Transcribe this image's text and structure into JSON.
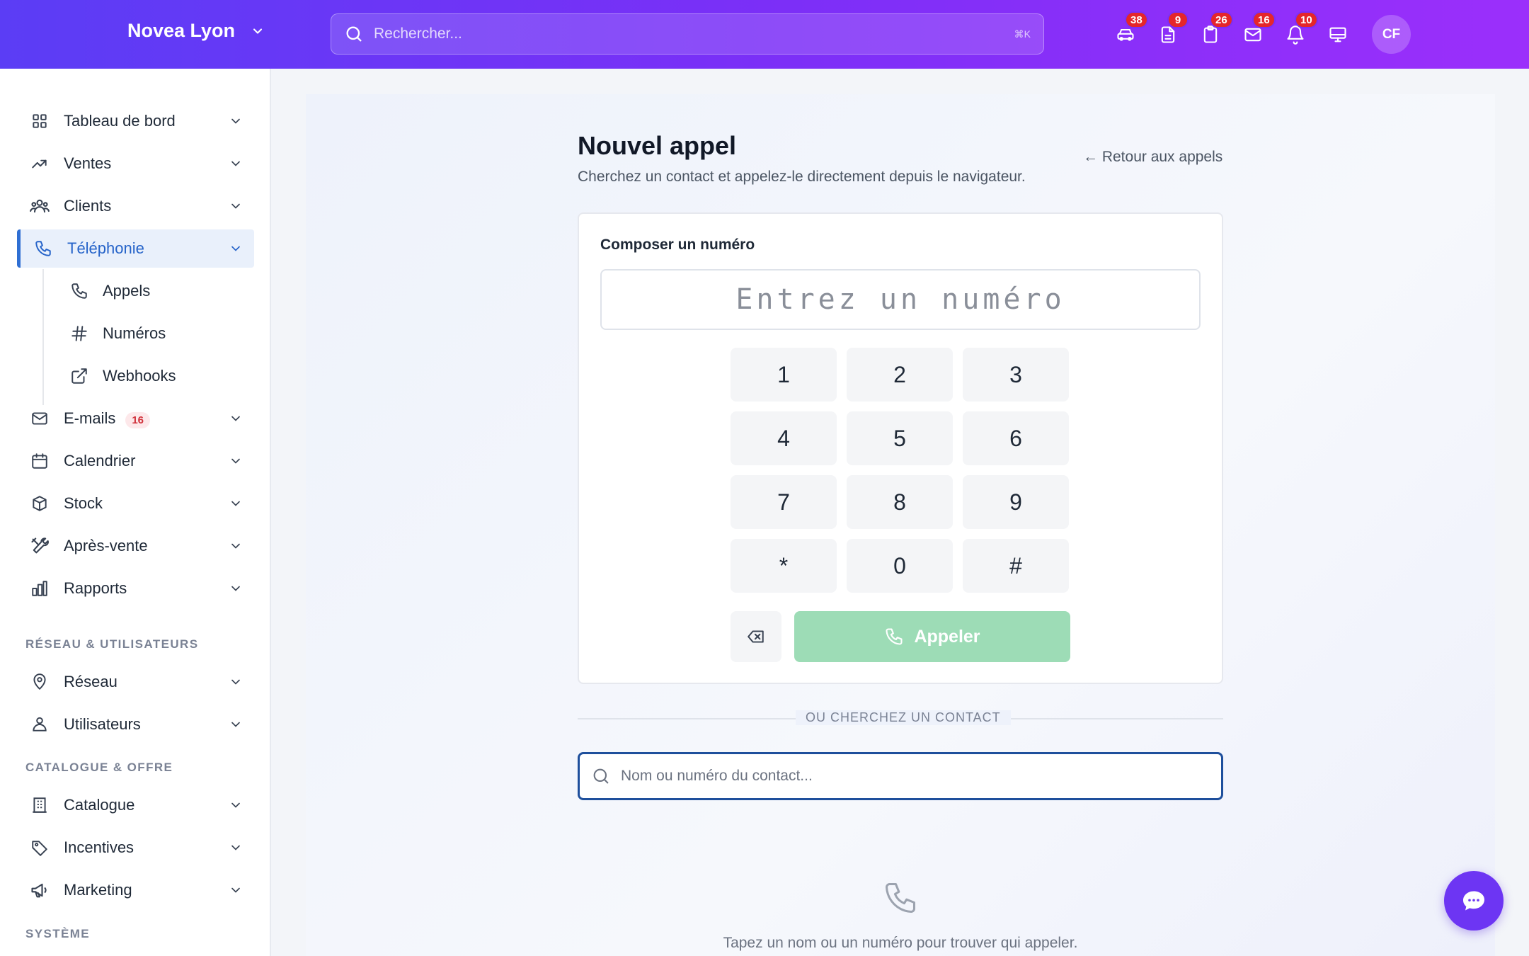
{
  "header": {
    "brand": "Novea Lyon",
    "search_placeholder": "Rechercher...",
    "search_shortcut": "⌘K",
    "icons": [
      {
        "name": "car-icon",
        "badge": "38"
      },
      {
        "name": "document-icon",
        "badge": "9"
      },
      {
        "name": "clipboard-icon",
        "badge": "26"
      },
      {
        "name": "mail-icon",
        "badge": "16"
      },
      {
        "name": "bell-icon",
        "badge": "10"
      },
      {
        "name": "monitor-icon",
        "badge": ""
      }
    ],
    "avatar": "CF"
  },
  "sidebar": {
    "items": [
      {
        "label": "Tableau de bord",
        "icon": "grid-icon"
      },
      {
        "label": "Ventes",
        "icon": "trend-icon"
      },
      {
        "label": "Clients",
        "icon": "users-icon"
      },
      {
        "label": "Téléphonie",
        "icon": "phone-icon",
        "active": true
      },
      {
        "label": "E-mails",
        "icon": "mail-icon",
        "count": "16"
      },
      {
        "label": "Calendrier",
        "icon": "calendar-icon"
      },
      {
        "label": "Stock",
        "icon": "box-icon"
      },
      {
        "label": "Après-vente",
        "icon": "tools-icon"
      },
      {
        "label": "Rapports",
        "icon": "chart-icon"
      }
    ],
    "subitems": [
      {
        "label": "Appels",
        "icon": "phone-icon"
      },
      {
        "label": "Numéros",
        "icon": "hash-icon"
      },
      {
        "label": "Webhooks",
        "icon": "external-link-icon"
      }
    ],
    "section_network": "RÉSEAU & UTILISATEURS",
    "network_items": [
      {
        "label": "Réseau",
        "icon": "map-pin-icon"
      },
      {
        "label": "Utilisateurs",
        "icon": "user-icon"
      }
    ],
    "section_catalog": "CATALOGUE & OFFRE",
    "catalog_items": [
      {
        "label": "Catalogue",
        "icon": "building-icon"
      },
      {
        "label": "Incentives",
        "icon": "tag-icon"
      },
      {
        "label": "Marketing",
        "icon": "megaphone-icon"
      }
    ],
    "section_system": "SYSTÈME"
  },
  "main": {
    "title": "Nouvel appel",
    "subtitle": "Cherchez un contact et appelez-le directement depuis le navigateur.",
    "back_link": "← Retour aux appels",
    "dial_label": "Composer un numéro",
    "dial_placeholder": "Entrez un numéro",
    "keys": [
      "1",
      "2",
      "3",
      "4",
      "5",
      "6",
      "7",
      "8",
      "9",
      "*",
      "0",
      "#"
    ],
    "call_button": "Appeler",
    "divider": "OU CHERCHEZ UN CONTACT",
    "contact_placeholder": "Nom ou numéro du contact...",
    "empty_text": "Tapez un nom ou un numéro pour trouver qui appeler."
  },
  "colors": {
    "accent": "#6d35f3",
    "active_nav": "#2563c9",
    "call_button": "#9ddcb6",
    "badge": "#e5262b"
  }
}
